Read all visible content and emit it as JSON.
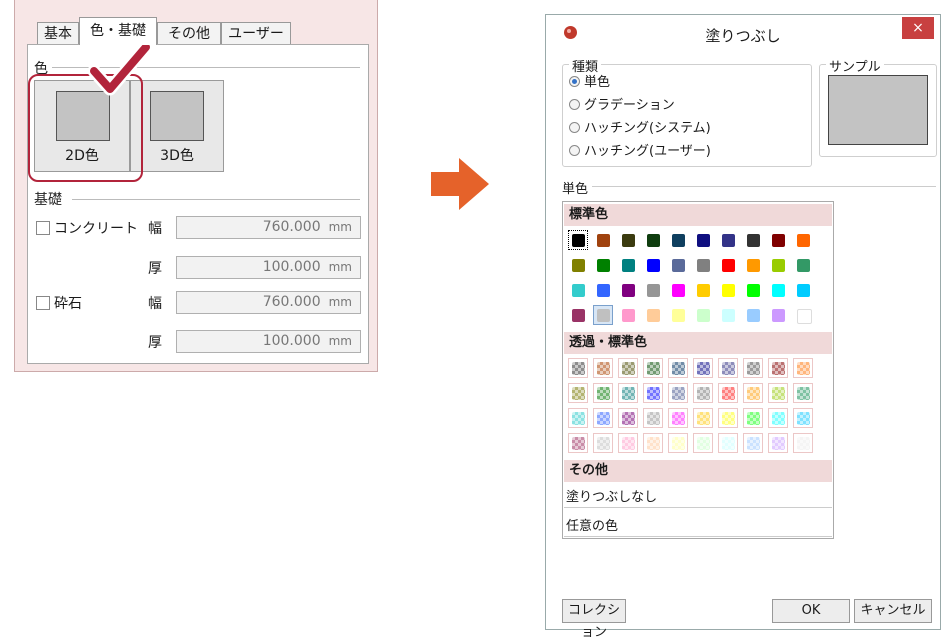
{
  "left_panel": {
    "tabs": [
      "基本",
      "色・基礎",
      "その他",
      "ユーザー"
    ],
    "color_group_label": "色",
    "btn_2d_label": "2D色",
    "btn_3d_label": "3D色",
    "foundation_group_label": "基礎",
    "concrete_label": "コンクリート",
    "gravel_label": "砕石",
    "width_label": "幅",
    "thickness_label": "厚",
    "fields": [
      {
        "value": "760.000",
        "unit": "mm"
      },
      {
        "value": "100.000",
        "unit": "mm"
      },
      {
        "value": "760.000",
        "unit": "mm"
      },
      {
        "value": "100.000",
        "unit": "mm"
      }
    ]
  },
  "dialog": {
    "title": "塗りつぶし",
    "close_glyph": "×",
    "type_group": "種類",
    "types": [
      "単色",
      "グラデーション",
      "ハッチング(システム)",
      "ハッチング(ユーザー)"
    ],
    "selected_type": "単色",
    "sample_group": "サンプル",
    "sample_color": "#c3c3c3",
    "solid_group": "単色",
    "standard_header": "標準色",
    "translucent_header": "透過・標準色",
    "other_header": "その他",
    "no_fill": "塗りつぶしなし",
    "custom_color": "任意の色",
    "collection_button": "コレクション",
    "ok_button": "OK",
    "cancel_button": "キャンセル",
    "standard_colors": [
      [
        "#000000",
        "#a0420e",
        "#3b3b0f",
        "#0f3d0f",
        "#0f3f5f",
        "#0f0f80",
        "#333388",
        "#333333",
        "#800000",
        "#ff6600"
      ],
      [
        "#808000",
        "#008000",
        "#008080",
        "#0000ff",
        "#5a6a9a",
        "#808080",
        "#ff0000",
        "#ff9900",
        "#99cc00",
        "#339966"
      ],
      [
        "#33cccc",
        "#3366ff",
        "#800080",
        "#969696",
        "#ff00ff",
        "#ffcc00",
        "#ffff00",
        "#00ff00",
        "#00ffff",
        "#00ccff"
      ],
      [
        "#993366",
        "#c0c0c0",
        "#ff99cc",
        "#ffcc99",
        "#ffff99",
        "#ccffcc",
        "#ccffff",
        "#99ccff",
        "#cc99ff",
        "#ffffff"
      ]
    ],
    "translucent_colors": [
      [
        "#7a7a7a",
        "#c8845a",
        "#8a8a5a",
        "#5a8a5a",
        "#5a7a9a",
        "#5a5ab0",
        "#7a7ab0",
        "#8a8a8a",
        "#b05a5a",
        "#ffaa66"
      ],
      [
        "#a8a85a",
        "#5aa85a",
        "#5aa8a8",
        "#5a5aff",
        "#8a94b8",
        "#a8a8a8",
        "#ff6a6a",
        "#ffc266",
        "#bede66",
        "#6ab894"
      ],
      [
        "#78dede",
        "#7a9aff",
        "#a85aa8",
        "#bcbcbc",
        "#ff6aff",
        "#ffde66",
        "#ffff6a",
        "#6aff6a",
        "#6affff",
        "#6adeff"
      ],
      [
        "#c07a9a",
        "#d8d8d8",
        "#ffc2de",
        "#ffdec2",
        "#ffffc2",
        "#deffde",
        "#deffff",
        "#c2deff",
        "#dec2ff",
        "#f4f4f4"
      ]
    ]
  }
}
